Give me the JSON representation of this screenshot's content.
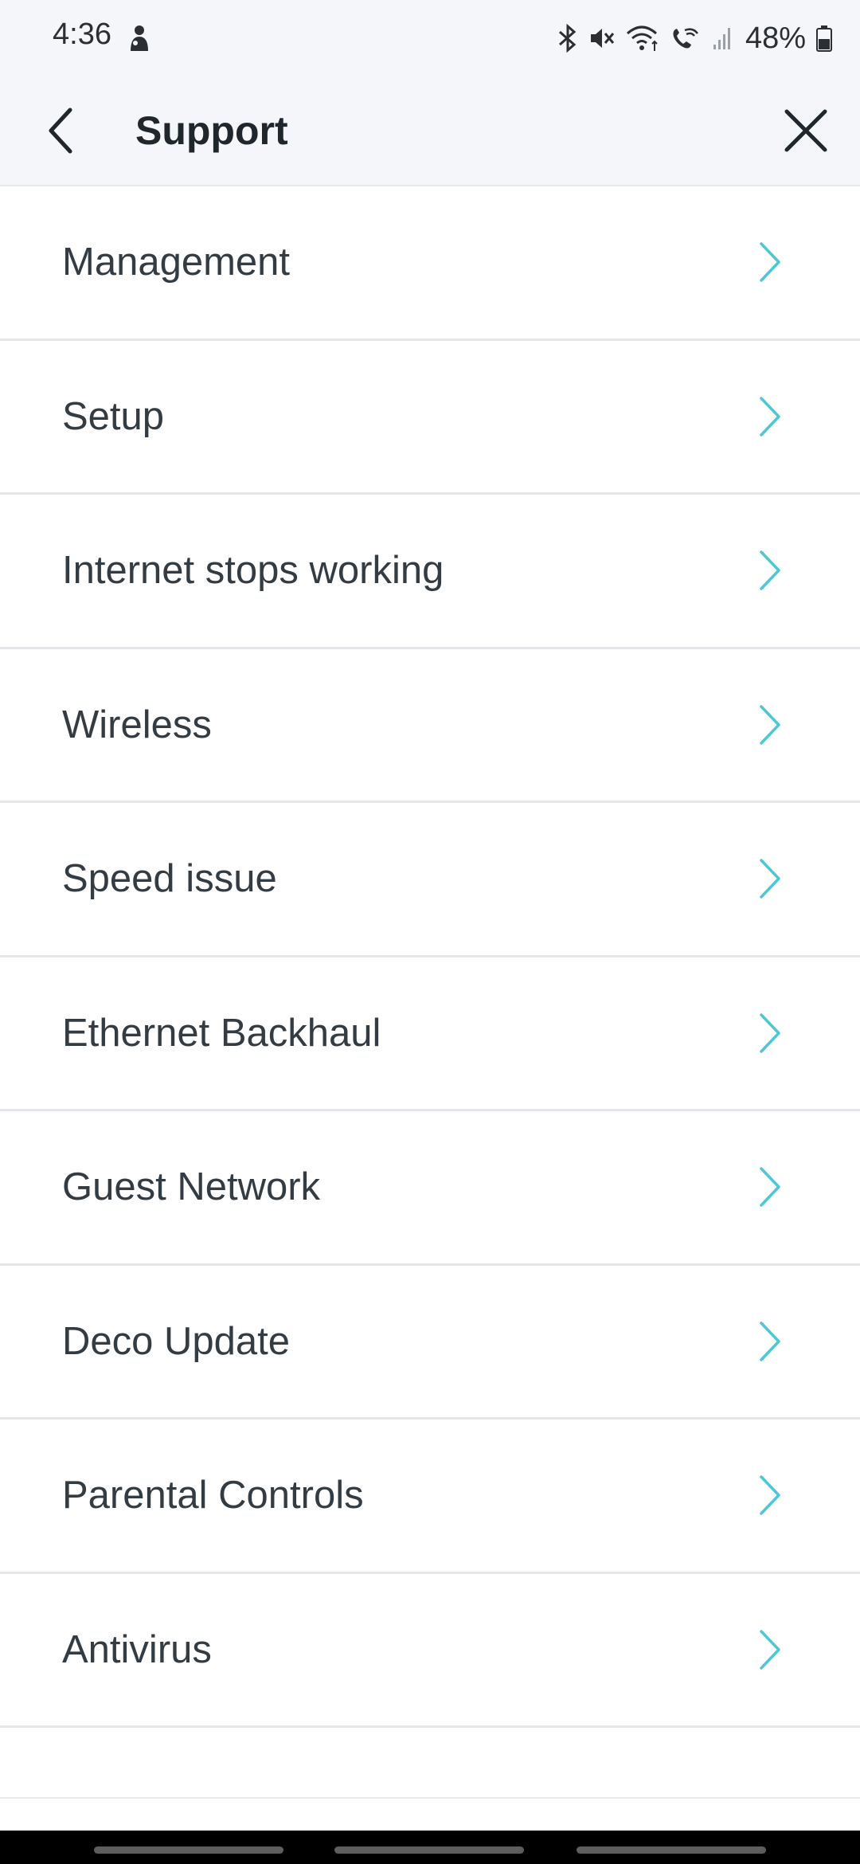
{
  "status_bar": {
    "time": "4:36",
    "battery": "48%",
    "icons": [
      "person-icon",
      "bluetooth-icon",
      "mute-icon",
      "wifi-icon",
      "wifi-calling-icon",
      "signal-icon",
      "battery-icon"
    ]
  },
  "header": {
    "title": "Support",
    "back_icon": "chevron-left-icon",
    "close_icon": "close-icon"
  },
  "topics": [
    {
      "label": "Management"
    },
    {
      "label": "Setup"
    },
    {
      "label": "Internet stops working"
    },
    {
      "label": "Wireless"
    },
    {
      "label": "Speed issue"
    },
    {
      "label": "Ethernet Backhaul"
    },
    {
      "label": "Guest Network"
    },
    {
      "label": "Deco Update"
    },
    {
      "label": "Parental Controls"
    },
    {
      "label": "Antivirus"
    }
  ],
  "colors": {
    "accent": "#4cc8d4",
    "header_bg": "#f4f6fa",
    "text": "#333b43"
  }
}
